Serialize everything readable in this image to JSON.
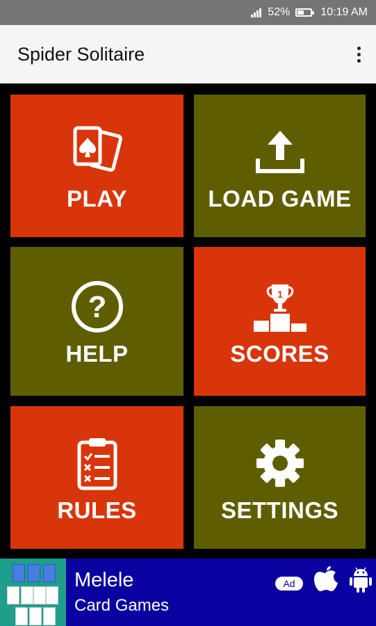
{
  "status_bar": {
    "battery": "52%",
    "time": "10:19 AM"
  },
  "app_bar": {
    "title": "Spider Solitaire"
  },
  "tiles": [
    {
      "label": "PLAY",
      "icon": "cards-icon",
      "color": "#d9350a"
    },
    {
      "label": "LOAD GAME",
      "icon": "upload-icon",
      "color": "#5e5e00"
    },
    {
      "label": "HELP",
      "icon": "help-icon",
      "color": "#5e5e00"
    },
    {
      "label": "SCORES",
      "icon": "trophy-podium-icon",
      "color": "#d9350a"
    },
    {
      "label": "RULES",
      "icon": "clipboard-checklist-icon",
      "color": "#d9350a"
    },
    {
      "label": "SETTINGS",
      "icon": "gear-icon",
      "color": "#5e5e00"
    }
  ],
  "ad": {
    "title": "Melele",
    "subtitle": "Card Games",
    "badge": "Ad",
    "background": "#0a00a0"
  }
}
